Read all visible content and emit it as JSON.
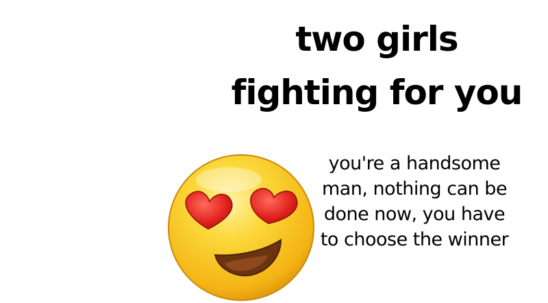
{
  "headline": {
    "line1": "two girls",
    "line2": "fighting for you"
  },
  "subtext": {
    "line1": "you're a handsome",
    "line2": "man, nothing can be",
    "line3": "done now, you have",
    "line4": "to choose the winner"
  },
  "emoji": {
    "icon": "heart-eyes-emoji-icon",
    "face_color": "#f7c21e",
    "heart_color": "#e0211c",
    "mouth_color": "#6b3410"
  }
}
